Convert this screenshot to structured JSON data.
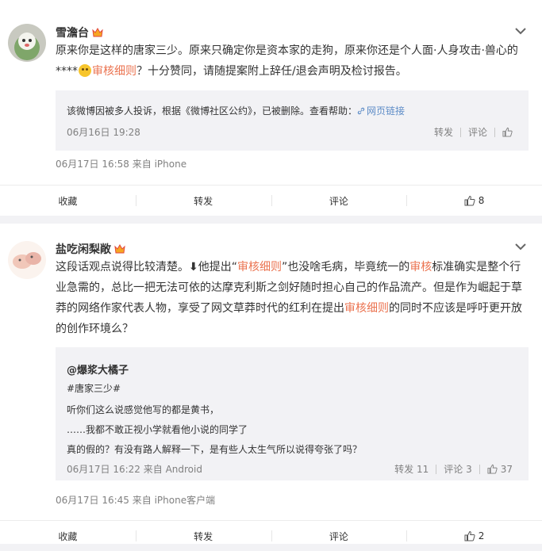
{
  "post1": {
    "username": "雪澹台",
    "text_part1": "原来你是这样的唐家三少。原来只确定你是资本家的走狗，原来你还是个人面·人身攻击·兽心",
    "text_part2": "的****",
    "text_highlight": "审核细则",
    "text_part3": "？十分赞同，请随提案附上辞任/退会声明及检讨报告。",
    "notice_text": "该微博因被多人投诉，根据《微博社区公约》，已被删除。查看帮助：",
    "notice_link": "网页链接",
    "quote_date": "06月16日 19:28",
    "quote_repost": "转发",
    "quote_comment": "评论",
    "meta": "06月17日 16:58  来自 iPhone",
    "footer": {
      "fav": "收藏",
      "repost": "转发",
      "comment": "评论",
      "like": "8"
    }
  },
  "post2": {
    "username": "盐吃闲梨敞",
    "text_a": "这段话观点说得比较清楚。",
    "text_arrow": "⬇",
    "text_b": "他提出“",
    "hl1": "审核细则",
    "text_c": "”也没啥毛病，毕竟统一的",
    "hl2": "审核",
    "text_d": "标准确实是整个行业急需的，总比一把无法可依的达摩克利斯之剑好随时担心自己的作品流产。但是作为崛起于草莽的网络作家代表人物，享受了网文草莽时代的红利在提出",
    "hl3": "审核细则",
    "text_e": "的同时不应该是呼吁更开放的创作环境么？",
    "quote_user": "@爆浆大橘子",
    "quote_tag": "#唐家三少#",
    "quote_line1": "听你们这么说感觉他写的都是黄书，",
    "quote_line2": "……我都不敢正视小学就看他小说的同学了",
    "quote_line3": "真的假的？有没有路人解释一下，是有些人太生气所以说得夸张了吗？",
    "quote_meta": "06月17日 16:22  来自 Android",
    "quote_repost": "转发 11",
    "quote_comment": "评论 3",
    "quote_like": "37",
    "meta": "06月17日 16:45  来自 iPhone客户端",
    "footer": {
      "fav": "收藏",
      "repost": "转发",
      "comment": "评论",
      "like": "2"
    }
  },
  "icons": {
    "vip": "vip-crown-icon",
    "chevron": "chevron-down-icon",
    "like": "thumbs-up-icon",
    "link": "link-icon"
  },
  "colors": {
    "highlight": "#eb7350",
    "link": "#5d8cc7",
    "background": "#f2f2f5"
  }
}
